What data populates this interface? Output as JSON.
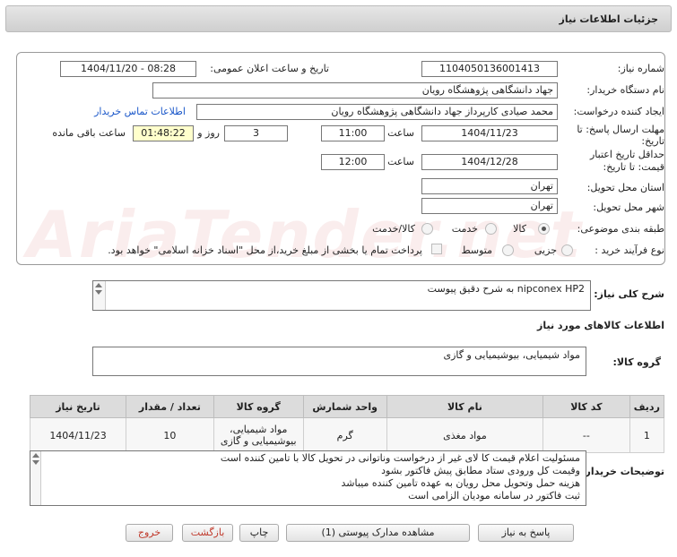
{
  "header": {
    "title": "جزئیات اطلاعات نیاز"
  },
  "form": {
    "need_number_label": "شماره نیاز:",
    "need_number": "1104050136001413",
    "announce_label": "تاریخ و ساعت اعلان عمومی:",
    "announce_value": "1404/11/20 - 08:28",
    "buyer_org_label": "نام دستگاه خریدار:",
    "buyer_org": "جهاد دانشگاهی پژوهشگاه رویان",
    "requester_label": "ایجاد کننده درخواست:",
    "requester": "محمد صیادی کارپرداز جهاد دانشگاهی پژوهشگاه رویان",
    "contact_link": "اطلاعات تماس خریدار",
    "deadline_label_1": "مهلت ارسال پاسخ: تا",
    "deadline_label_2": "تاریخ:",
    "deadline_date": "1404/11/23",
    "time_word": "ساعت",
    "deadline_time": "11:00",
    "days_value": "3",
    "days_word": "روز و",
    "remaining_time": "01:48:22",
    "remaining_word": "ساعت باقی مانده",
    "validity_label_1": "حداقل تاریخ اعتبار",
    "validity_label_2": "قیمت: تا تاریخ:",
    "validity_date": "1404/12/28",
    "validity_time": "12:00",
    "province_label": "استان محل تحویل:",
    "province": "تهران",
    "city_label": "شهر محل تحویل:",
    "city": "تهران",
    "category_label": "طبقه بندی موضوعی:",
    "category_options": [
      "کالا",
      "خدمت",
      "کالا/خدمت"
    ],
    "category_selected": "کالا",
    "process_label": "نوع فرآیند خرید :",
    "process_options": [
      "جزیی",
      "متوسط"
    ],
    "payment_note": "پرداخت تمام یا بخشی از مبلغ خرید،از محل \"اسناد خزانه اسلامی\" خواهد بود."
  },
  "need": {
    "summary_label": "شرح کلی نیاز:",
    "summary": "nipconex HP2     به شرح دقیق پیوست",
    "items_heading": "اطلاعات کالاهای مورد نیاز",
    "group_label": "گروه کالا:",
    "group_value": "مواد شیمیایی، بیوشیمیایی و  گازی"
  },
  "table": {
    "headers": [
      "ردیف",
      "کد کالا",
      "نام کالا",
      "واحد شمارش",
      "گروه کالا",
      "تعداد / مقدار",
      "تاریخ نیاز"
    ],
    "rows": [
      {
        "row": "1",
        "code": "--",
        "name": "مواد مغذی",
        "unit": "گرم",
        "group": "مواد شیمیایی، بیوشیمیایی و گازی",
        "qty": "10",
        "date": "1404/11/23"
      }
    ]
  },
  "notes": {
    "label": "توضیحات خریدار:",
    "lines": [
      "مسئولیت اعلام قیمت کا لای  غیر از درخواست وناتوانی در تحویل کالا با تامین کننده است",
      "وقیمت کل ورودی ستاد مطابق پیش فاکتور بشود",
      "هزینه حمل وتحویل محل رویان به عهده تامین کننده میباشد",
      "ثبت فاکتور در سامانه مودیان الزامی است"
    ]
  },
  "buttons": {
    "reply": "پاسخ به نیاز",
    "attachments": "مشاهده مدارک پیوستی (1)",
    "print": "چاپ",
    "back": "بازگشت",
    "exit": "خروج"
  },
  "watermark": "AriaTender.net",
  "colors": {
    "link": "#1a57c9",
    "remaining_bg": "#ffffcc",
    "exit_text": "#c0392b"
  }
}
